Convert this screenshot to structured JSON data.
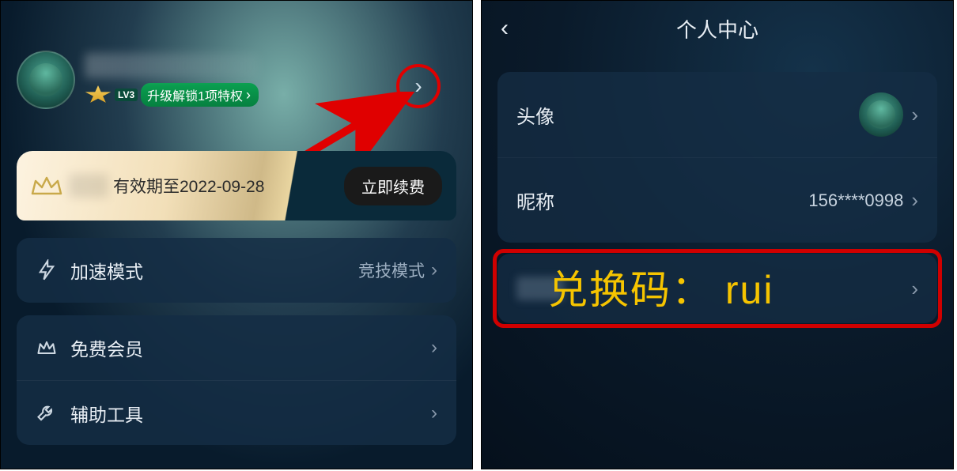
{
  "left": {
    "level_tag": "LV3",
    "unlock_text": "升级解锁1项特权",
    "vip_expiry_prefix": "有效期至",
    "vip_expiry_date": "2022-09-28",
    "renew_label": "立即续费",
    "rows": {
      "accel": {
        "label": "加速模式",
        "value": "竞技模式"
      },
      "free": {
        "label": "免费会员"
      },
      "tools": {
        "label": "辅助工具"
      }
    }
  },
  "right": {
    "title": "个人中心",
    "avatar_label": "头像",
    "nickname_label": "昵称",
    "nickname_value": "156****0998",
    "annotation_text": "兑换码：  rui"
  }
}
